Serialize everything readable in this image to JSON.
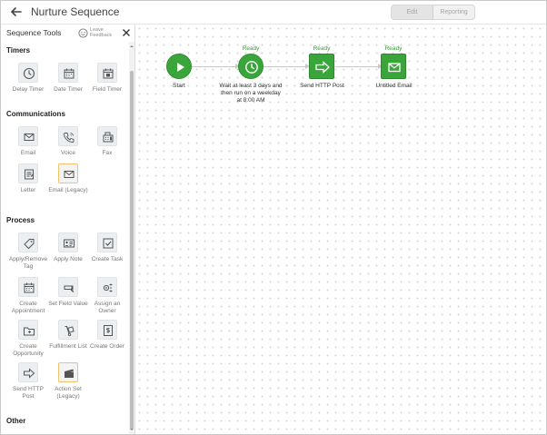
{
  "header": {
    "title": "Nurture Sequence",
    "back_icon": "arrow-left-icon",
    "edit_label": "Edit",
    "reporting_label": "Reporting"
  },
  "sidebar": {
    "title": "Sequence Tools",
    "feedback_label": "Leave Feedback",
    "sections": {
      "timers": "Timers",
      "communications": "Communications",
      "process": "Process",
      "other": "Other"
    },
    "timers": [
      "Delay Timer",
      "Date Timer",
      "Field Timer"
    ],
    "communications": [
      "Email",
      "Voice",
      "Fax",
      "Letter",
      "Email (Legacy)"
    ],
    "process": [
      "Apply/Remove Tag",
      "Apply Note",
      "Create Task",
      "Create Appointment",
      "Set Field Value",
      "Assign an Owner",
      "Create Opportunity",
      "Fulfillment List",
      "Create Order",
      "Send HTTP Post",
      "Action Set (Legacy)"
    ]
  },
  "canvas": {
    "nodes": [
      {
        "label": "Start",
        "status": "",
        "icon": "play-icon"
      },
      {
        "label": "Wait at least 3 days and then run on a weekday at 8:00 AM",
        "status": "Ready",
        "icon": "clock-icon"
      },
      {
        "label": "Send HTTP Post",
        "status": "Ready",
        "icon": "http-post-icon"
      },
      {
        "label": "Untitled Email",
        "status": "Ready",
        "icon": "envelope-icon"
      }
    ]
  },
  "colors": {
    "accent_green": "#3aa53a",
    "legacy_border": "#f0c36a"
  }
}
